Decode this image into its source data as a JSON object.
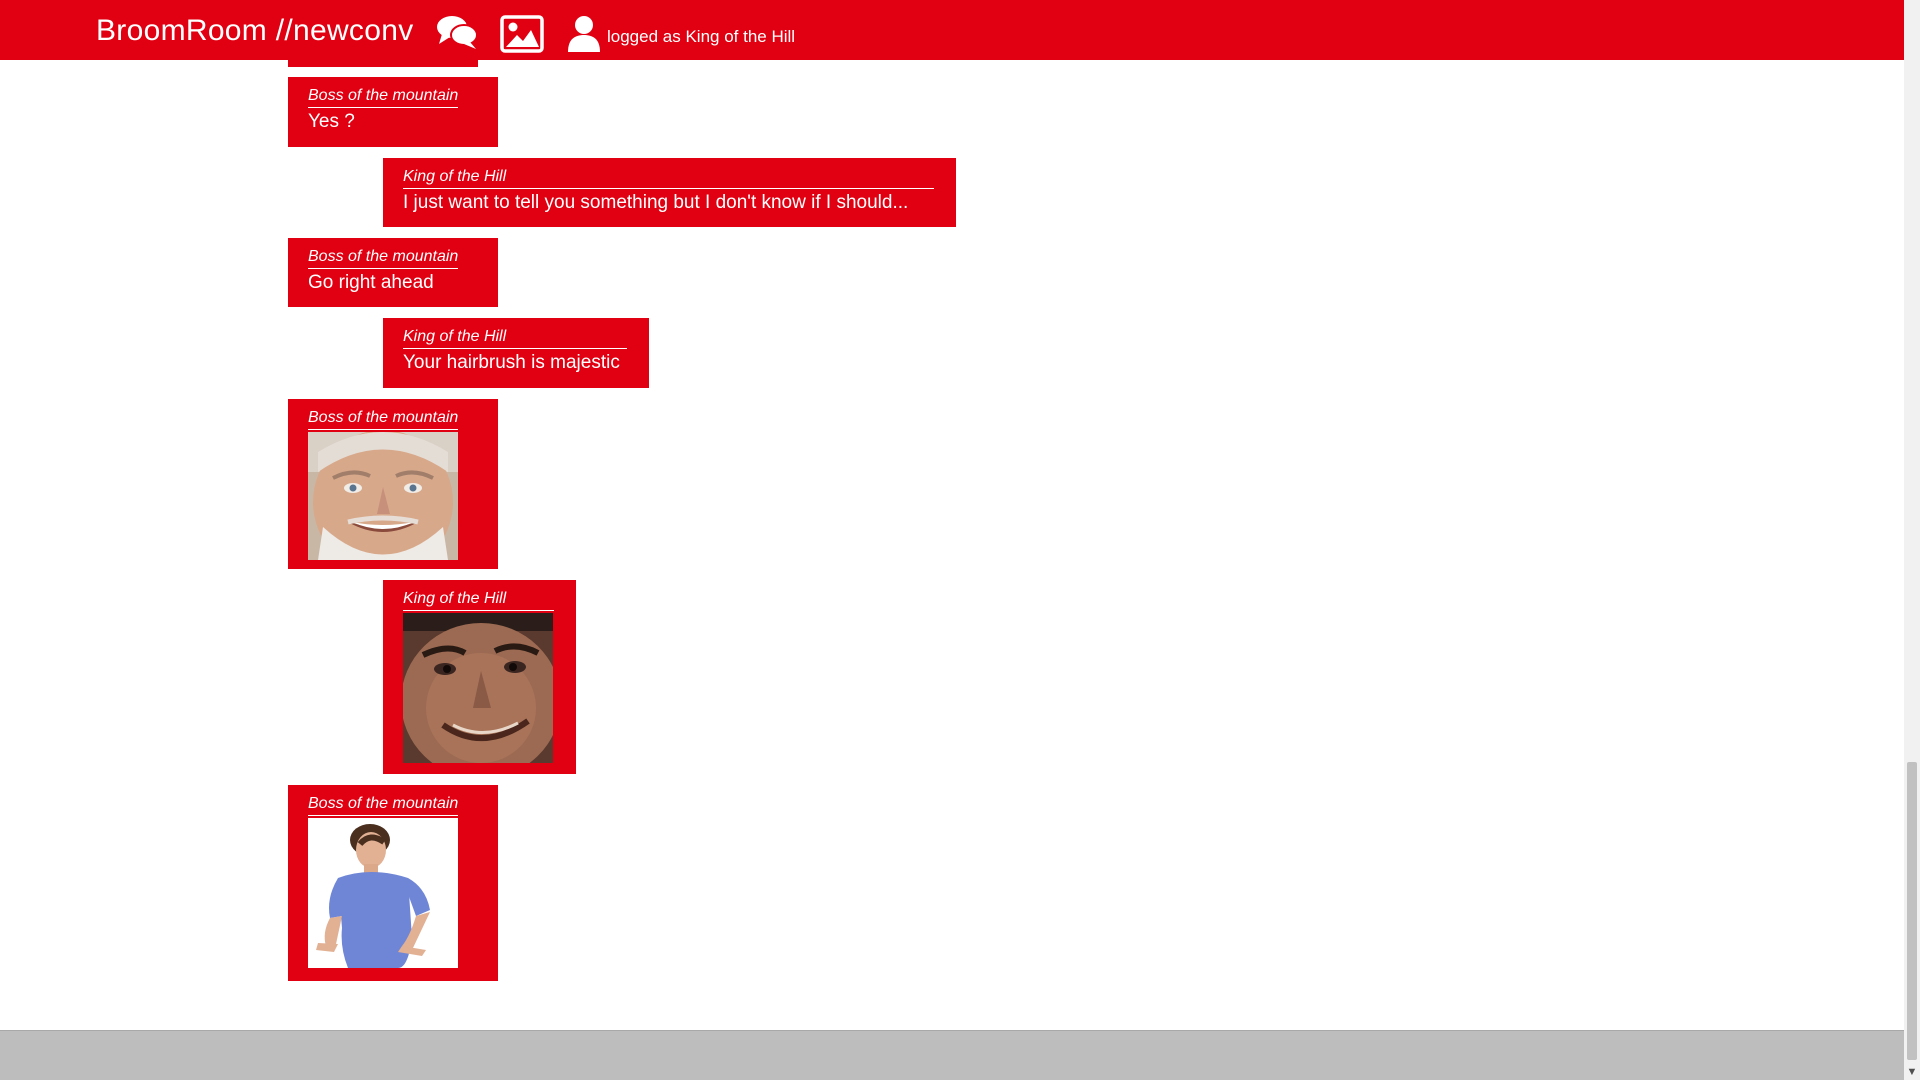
{
  "header": {
    "brand": "BroomRoom //newconv",
    "login_status": "logged as King of the Hill",
    "icons": [
      "chat-bubbles-icon",
      "image-icon",
      "user-icon"
    ],
    "color": "#e00012"
  },
  "messages": [
    {
      "author": "Boss of the mountain",
      "text": "Yes ?"
    },
    {
      "author": "King of the Hill",
      "text": "I just want to tell you something but I don't know if I should..."
    },
    {
      "author": "Boss of the mountain",
      "text": "Go right ahead"
    },
    {
      "author": "King of the Hill",
      "text": "Your hairbrush is majestic"
    },
    {
      "author": "Boss of the mountain",
      "image": "smiling-old-man-photo"
    },
    {
      "author": "King of the Hill",
      "image": "grinning-face-closeup-photo"
    },
    {
      "author": "Boss of the mountain",
      "image": "young-man-blue-shirt-photo"
    }
  ],
  "colors": {
    "accent": "#e00012",
    "text_on_accent": "#ffffff",
    "composer_bg": "#bdbdbd"
  }
}
